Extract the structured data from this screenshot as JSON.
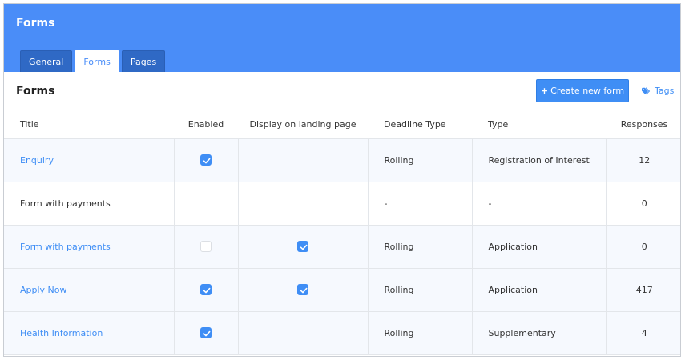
{
  "header": {
    "title": "Forms",
    "tabs": [
      {
        "label": "General",
        "active": false
      },
      {
        "label": "Forms",
        "active": true
      },
      {
        "label": "Pages",
        "active": false
      }
    ]
  },
  "section": {
    "title": "Forms",
    "create_button": "Create new form",
    "tags_link": "Tags"
  },
  "table": {
    "columns": [
      "Title",
      "Enabled",
      "Display on landing page",
      "Deadline Type",
      "Type",
      "Responses"
    ],
    "rows": [
      {
        "title": "Enquiry",
        "is_link": true,
        "enabled": "checked",
        "display": "none",
        "deadline": "Rolling",
        "type": "Registration of Interest",
        "responses": "12"
      },
      {
        "title": "Form with payments",
        "is_link": false,
        "enabled": "none",
        "display": "none",
        "deadline": "-",
        "type": "-",
        "responses": "0"
      },
      {
        "title": "Form with payments",
        "is_link": true,
        "enabled": "unchecked",
        "display": "checked",
        "deadline": "Rolling",
        "type": "Application",
        "responses": "0"
      },
      {
        "title": "Apply Now",
        "is_link": true,
        "enabled": "checked",
        "display": "checked",
        "deadline": "Rolling",
        "type": "Application",
        "responses": "417"
      },
      {
        "title": "Health Information",
        "is_link": true,
        "enabled": "checked",
        "display": "none",
        "deadline": "Rolling",
        "type": "Supplementary",
        "responses": "4"
      }
    ]
  },
  "icons": {
    "create": "plus-icon",
    "tags": "tag-icon",
    "checkbox": "check-icon"
  },
  "colors": {
    "header_bg": "#4a8df8",
    "tab_bg": "#2f69c5",
    "accent": "#3f8ef5",
    "row_bg": "#f6f9fe"
  }
}
